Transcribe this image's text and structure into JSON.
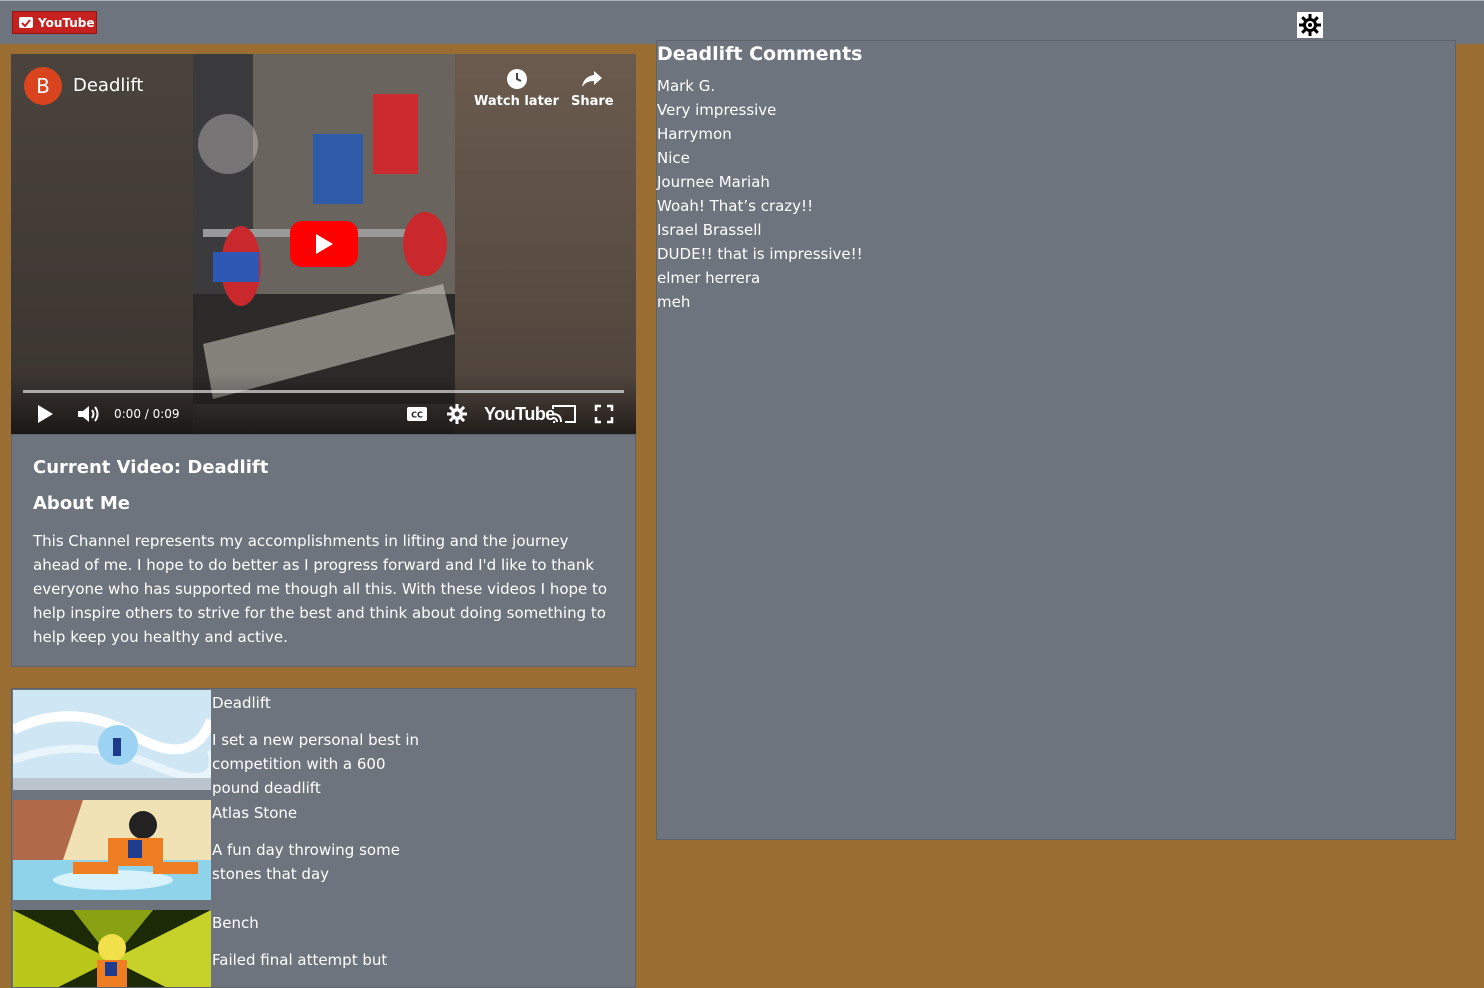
{
  "header": {
    "logo_label": "YouTube",
    "settings_icon": "gear-icon"
  },
  "video": {
    "channel_initial": "B",
    "title": "Deadlift",
    "watch_later": "Watch later",
    "share": "Share",
    "time": "0:00 / 0:09",
    "brand": "YouTube",
    "icons": [
      "play-icon",
      "volume-icon",
      "cc-icon",
      "settings-icon",
      "cast-icon",
      "fullscreen-icon"
    ]
  },
  "about": {
    "current_video": "Current Video: Deadlift",
    "heading": "About Me",
    "text": "This Channel represents my accomplishments in lifting and the journey ahead of me. I hope to do better as I progress forward and I'd like to thank everyone who has supported me though all this. With these videos I hope to help inspire others to strive for the best and think about doing something to help keep you healthy and active."
  },
  "playlist": [
    {
      "title": "Deadlift",
      "description": "I set a new personal best in competition with a 600 pound deadlift"
    },
    {
      "title": "Atlas Stone",
      "description": "A fun day throwing some stones that day"
    },
    {
      "title": "Bench",
      "description": "Failed final attempt but"
    }
  ],
  "comments": {
    "heading": "Deadlift Comments",
    "items": [
      {
        "author": "Mark G.",
        "text": "Very impressive"
      },
      {
        "author": "Harrymon",
        "text": "Nice"
      },
      {
        "author": "Journee Mariah",
        "text": "Woah! That’s crazy!!"
      },
      {
        "author": "Israel Brassell",
        "text": "DUDE!! that is impressive!!"
      },
      {
        "author": "elmer herrera",
        "text": "meh"
      }
    ]
  }
}
